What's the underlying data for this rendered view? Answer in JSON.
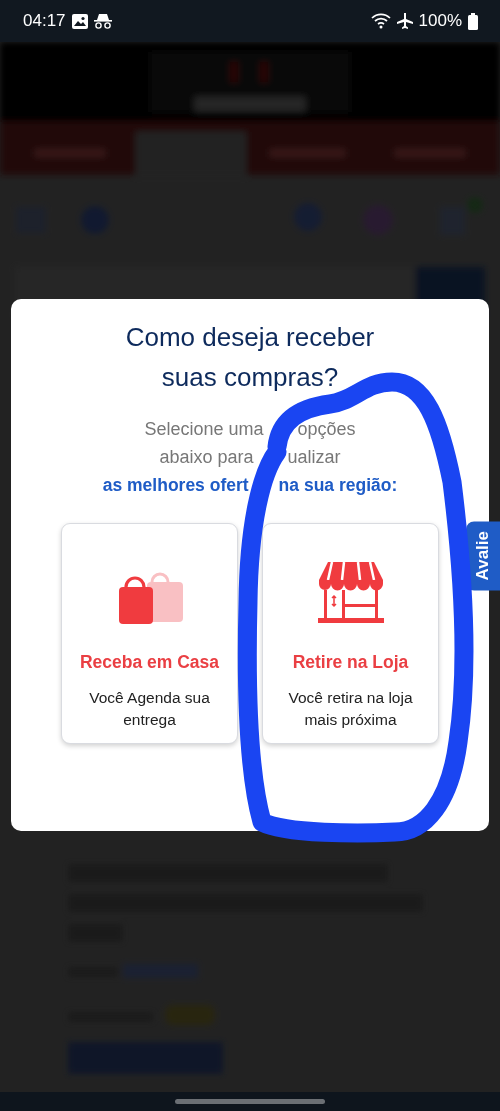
{
  "status_bar": {
    "time": "04:17",
    "battery": "100%"
  },
  "modal": {
    "title": "Como deseja receber suas compras?",
    "subtitle_lines": [
      {
        "kind": "muted",
        "parts": [
          "Selecione uma",
          "opções"
        ]
      },
      {
        "kind": "muted",
        "parts": [
          "abaixo para",
          "ualizar"
        ]
      },
      {
        "kind": "highlight",
        "parts": [
          "as melhores ofert",
          "na sua região:"
        ]
      }
    ],
    "options": [
      {
        "kind": "bags",
        "title": "Receba em Casa",
        "description": "Você Agenda sua entrega"
      },
      {
        "kind": "store",
        "title": "Retire na Loja",
        "description": "Você retira na loja mais próxima"
      }
    ]
  },
  "feedback_tab": {
    "label": "Avalie"
  }
}
